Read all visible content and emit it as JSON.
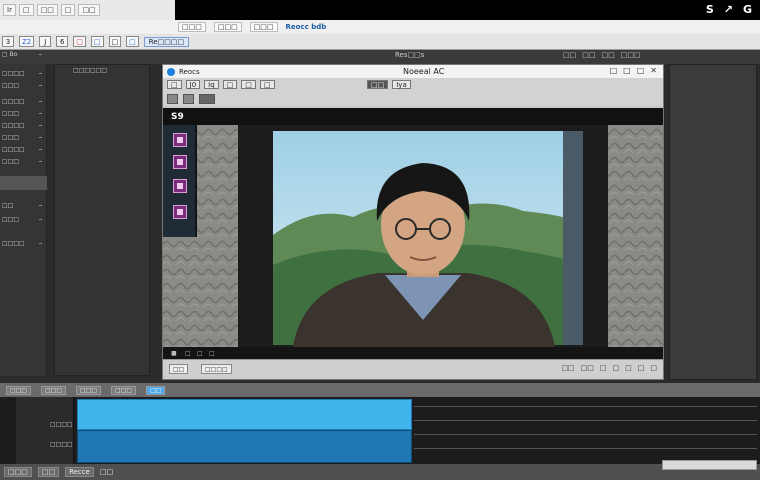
{
  "window": {
    "controls": [
      "S",
      "↗",
      "G"
    ]
  },
  "tabbar": {
    "tabs": [
      "Ir",
      "□",
      "□□",
      "□",
      "□□"
    ]
  },
  "menubar": {
    "items": [
      "□□□",
      "□□□",
      "□□□"
    ],
    "brand": "Reocc bdb"
  },
  "toolbar": {
    "buttons": [
      "3",
      "Z2",
      "J",
      "6",
      "□",
      "□",
      "□",
      "□"
    ],
    "label": "Re□□□□"
  },
  "panel_header": {
    "preview_title": "Res□□s",
    "right_items": [
      "□□",
      "□□",
      "□□",
      "□□□"
    ]
  },
  "left_panel": {
    "top_label": "□ Bo",
    "items": [
      "□□□□",
      "□□□",
      "□□□□",
      "□□□",
      "□□□□",
      "□□□",
      "□□□□",
      "□□□",
      "□□",
      "□□□",
      "□□□□"
    ]
  },
  "media_panel": {
    "label": "□□□□□□"
  },
  "preview": {
    "title": "Reocs",
    "file": "Noeeal AC",
    "icons": [
      "□",
      "□",
      "□",
      "✕"
    ],
    "tools_a": [
      "□",
      "J0",
      "Iq",
      "□",
      "□",
      "□"
    ],
    "tools_b": [
      "□□",
      "Iya"
    ],
    "sd_label": "S9",
    "bottom_items": [
      "■",
      "□",
      "□",
      "□"
    ],
    "status_chips": [
      "□□",
      "□□□□"
    ],
    "status_icons": [
      "□□",
      "□□",
      "□",
      "□",
      "□",
      "□",
      "□"
    ]
  },
  "timeline": {
    "ruler": [
      "□□□",
      "□□□",
      "□□□",
      "□□□",
      "□□"
    ],
    "track_labels": [
      "□□□□",
      "□□□□"
    ],
    "status": [
      "□□□",
      "□□",
      "Recce",
      "□□"
    ]
  },
  "colors": {
    "clip_light": "#40b4ec",
    "clip_dark": "#1f77b4",
    "accent": "#1e7fe0"
  }
}
